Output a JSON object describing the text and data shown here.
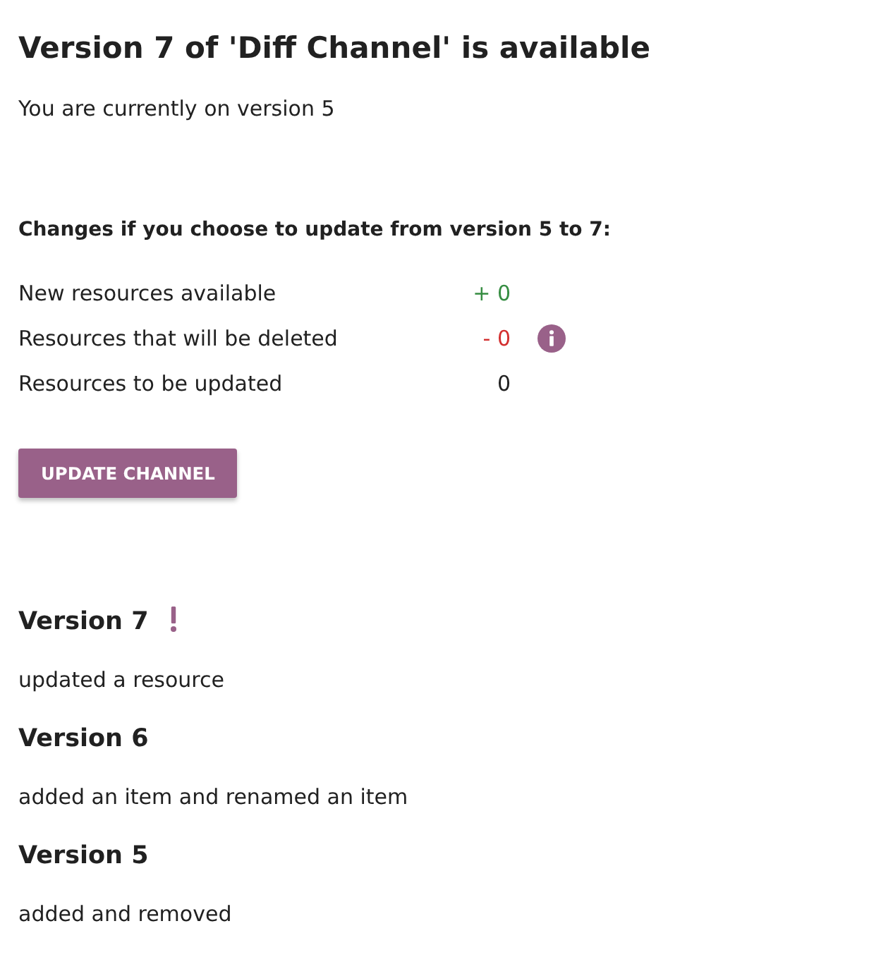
{
  "title": "Version 7 of 'Diff Channel' is available",
  "current_version": "You are currently on version 5",
  "changes": {
    "heading": "Changes if you choose to update from version 5 to 7:",
    "rows": [
      {
        "label": "New resources available",
        "value": "+ 0",
        "kind": "added",
        "info": false
      },
      {
        "label": "Resources that will be deleted",
        "value": "- 0",
        "kind": "deleted",
        "info": true
      },
      {
        "label": "Resources to be updated",
        "value": "0",
        "kind": "updated",
        "info": false
      }
    ]
  },
  "update_button": "UPDATE CHANNEL",
  "versions": [
    {
      "title": "Version 7",
      "alert": true,
      "description": "updated a resource"
    },
    {
      "title": "Version 6",
      "alert": false,
      "description": "added an item and renamed an item"
    },
    {
      "title": "Version 5",
      "alert": false,
      "description": "added and removed"
    }
  ]
}
